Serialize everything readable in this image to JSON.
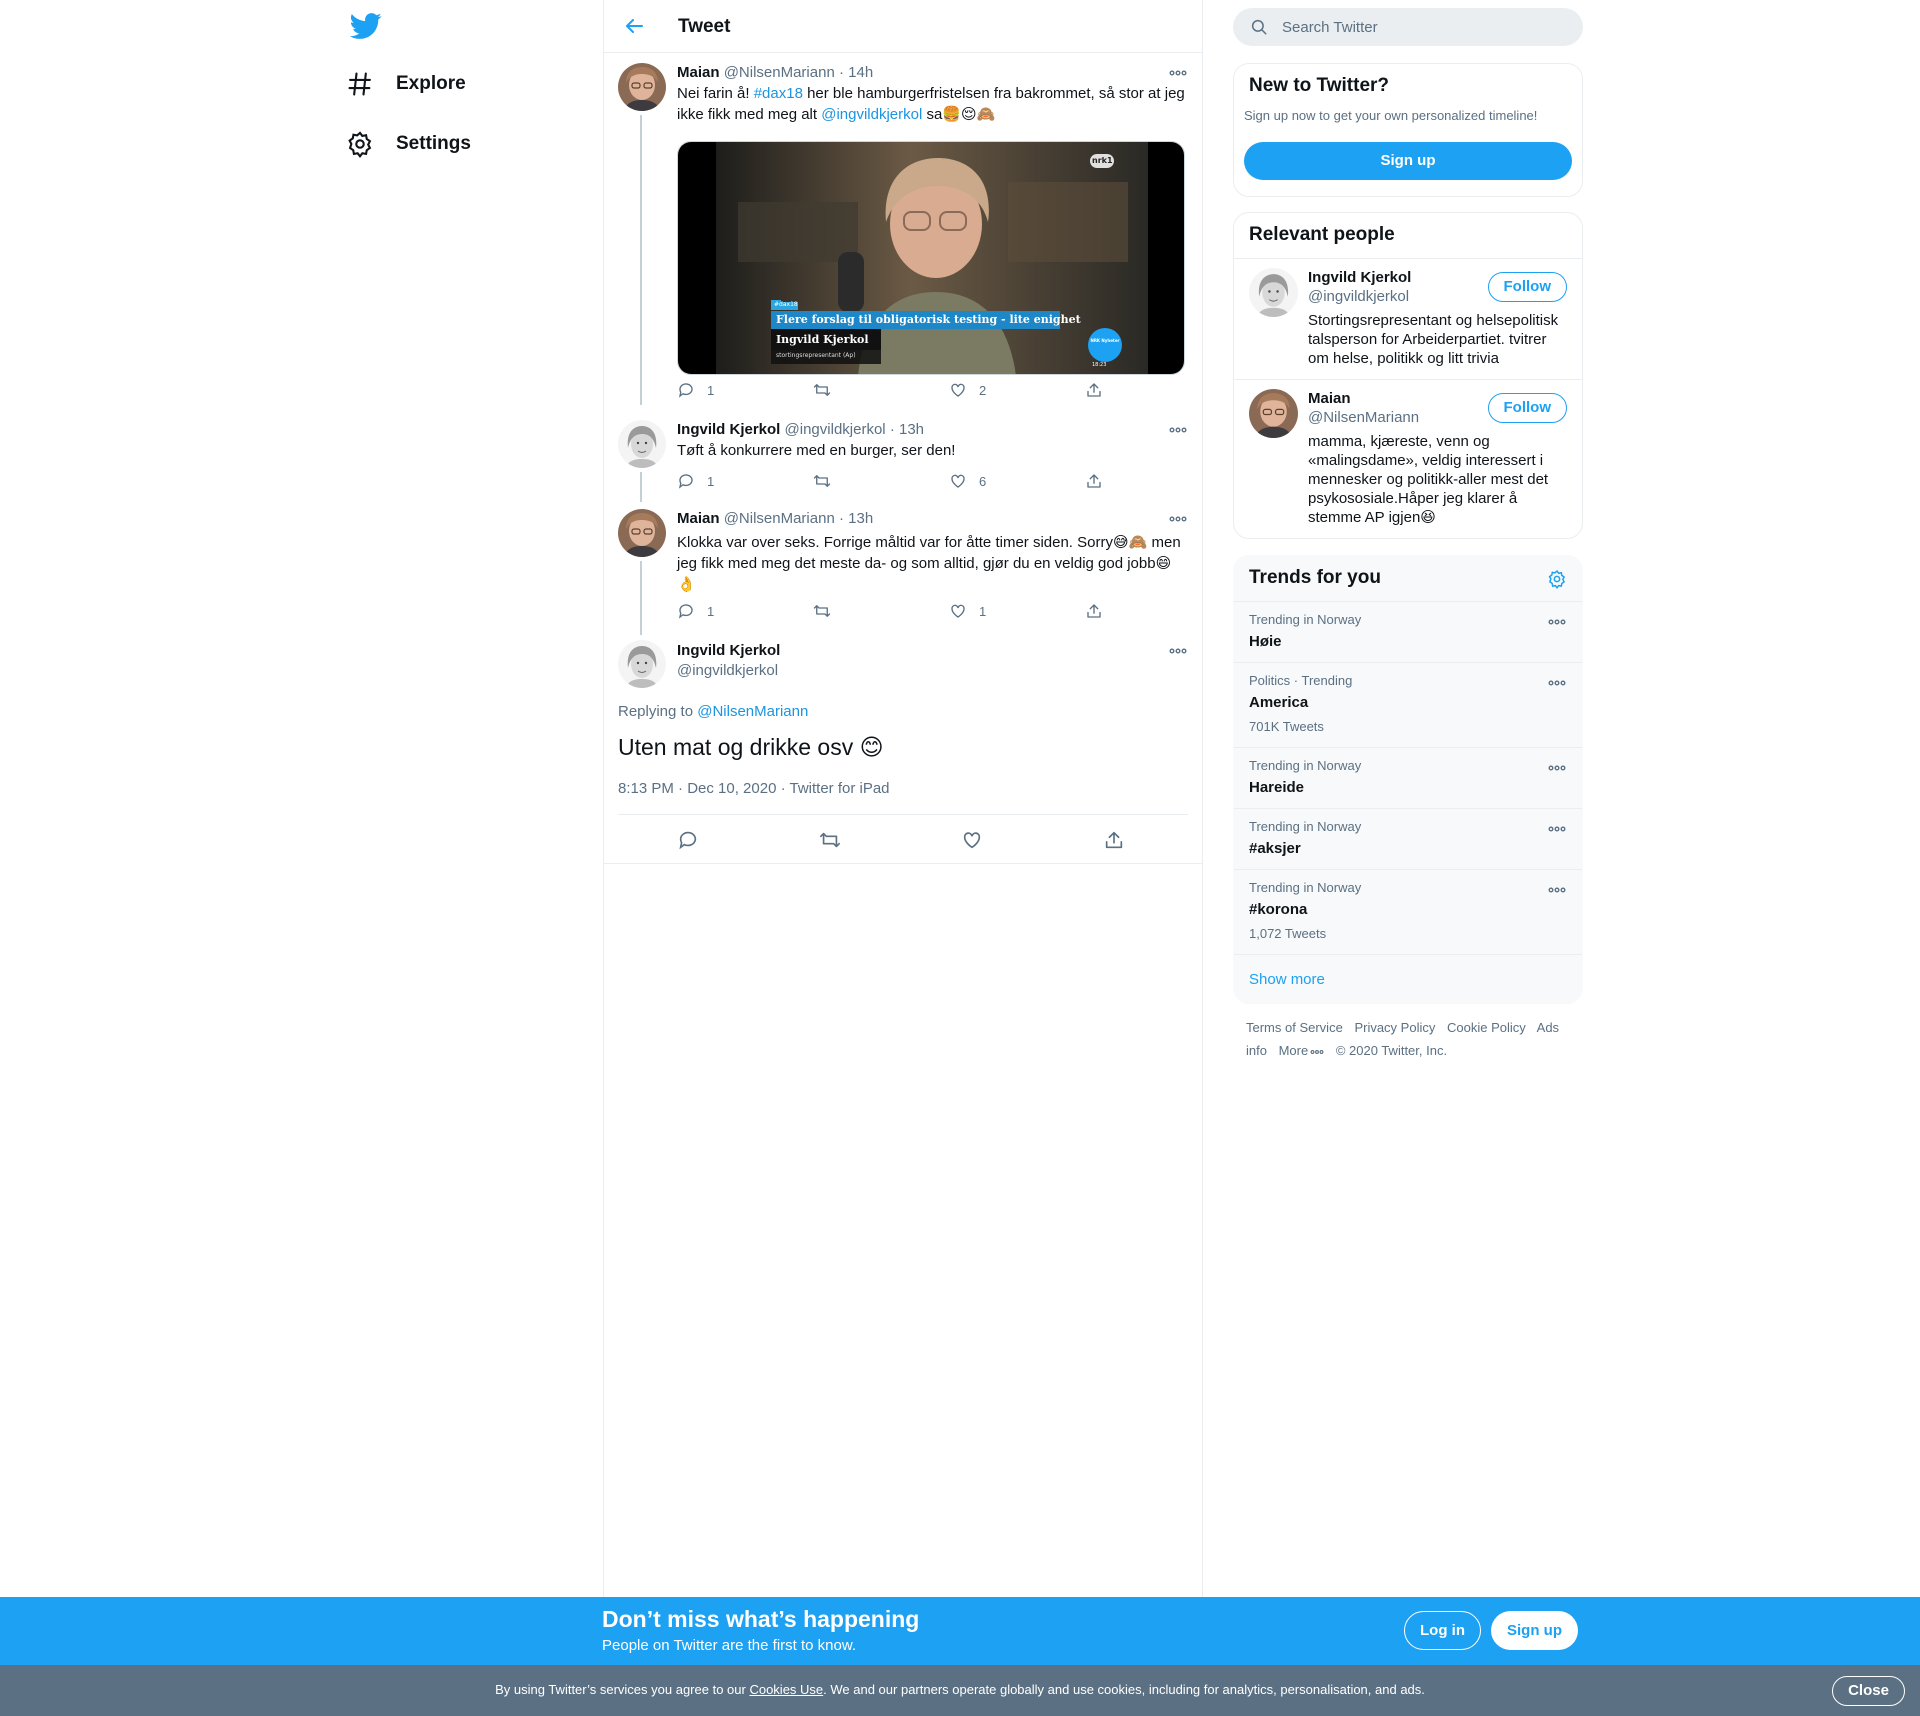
{
  "nav": {
    "logo_icon": "twitter-bird-icon",
    "items": [
      {
        "icon": "hashtag-icon",
        "label": "Explore"
      },
      {
        "icon": "gear-icon",
        "label": "Settings"
      }
    ]
  },
  "header": {
    "title": "Tweet",
    "back_icon": "arrow-left-icon"
  },
  "thread": [
    {
      "name": "Maian",
      "handle": "@NilsenMariann",
      "sep": "·",
      "time": "14h",
      "text_parts": [
        "Nei farin å! ",
        "#dax18",
        " her ble hamburgerfristelsen fra bakrommet, så stor at jeg ikke fikk med meg alt ",
        "@ingvildkjerkol",
        " sa",
        "🍔😌🙈"
      ],
      "media": {
        "headline_tag": "#dax18",
        "headline": "Flere forslag til obligatorisk testing - lite enighet",
        "person": "Ingvild Kjerkol",
        "role": "stortingsrepresentant (Ap)",
        "channel_top": "nrk1",
        "channel_logo": "NRK Nyheter",
        "clock": "18:23"
      },
      "reply_count": "1",
      "retweet_count": "",
      "like_count": "2"
    },
    {
      "name": "Ingvild Kjerkol",
      "handle": "@ingvildkjerkol",
      "sep": "·",
      "time": "13h",
      "text": "Tøft å konkurrere med en burger, ser den!",
      "reply_count": "1",
      "retweet_count": "",
      "like_count": "6"
    },
    {
      "name": "Maian",
      "handle": "@NilsenMariann",
      "sep": "·",
      "time": "13h",
      "text_line1": "Klokka var over seks. Forrige måltid var for åtte timer siden. Sorry",
      "emoji1": "😅🙈",
      "text_line2": "men jeg fikk med meg det meste da- og som alltid, gjør du en veldig god jobb",
      "emoji2": "😄👌",
      "reply_count": "1",
      "retweet_count": "",
      "like_count": "1"
    }
  ],
  "focus": {
    "name": "Ingvild Kjerkol",
    "handle": "@ingvildkjerkol",
    "replying_prefix": "Replying to",
    "replying_to": "@NilsenMariann",
    "text": "Uten mat og drikke osv",
    "emoji": "😊",
    "timestamp": "8:13 PM · Dec 10, 2020 · Twitter for iPad"
  },
  "sidebar": {
    "search_placeholder": "Search Twitter",
    "new_to_twitter": {
      "title": "New to Twitter?",
      "subtitle": "Sign up now to get your own personalized timeline!",
      "button": "Sign up"
    },
    "relevant": {
      "title": "Relevant people",
      "people": [
        {
          "name": "Ingvild Kjerkol",
          "handle": "@ingvildkjerkol",
          "bio": "Stortingsrepresentant og helsepolitisk talsperson for Arbeiderpartiet. tvitrer om helse, politikk og litt trivia",
          "follow": "Follow"
        },
        {
          "name": "Maian",
          "handle": "@NilsenMariann",
          "bio": "mamma, kjæreste, venn og «malingsdame», veldig interessert i mennesker og politikk-aller mest det psykososiale.Håper jeg klarer å stemme AP igjen",
          "bio_emoji": "😆",
          "follow": "Follow"
        }
      ]
    },
    "trends": {
      "title": "Trends for you",
      "settings_icon": "gear-icon",
      "items": [
        {
          "context": "Trending in Norway",
          "name": "Høie",
          "count": ""
        },
        {
          "context": "Politics · Trending",
          "name": "America",
          "count": "701K Tweets"
        },
        {
          "context": "Trending in Norway",
          "name": "Hareide",
          "count": ""
        },
        {
          "context": "Trending in Norway",
          "name": "#aksjer",
          "count": ""
        },
        {
          "context": "Trending in Norway",
          "name": "#korona",
          "count": "1,072 Tweets"
        }
      ],
      "show_more": "Show more"
    },
    "footer": {
      "terms": "Terms of Service",
      "privacy": "Privacy Policy",
      "cookie": "Cookie Policy",
      "ads": "Ads info",
      "more": "More",
      "copyright": "© 2020 Twitter, Inc."
    }
  },
  "signup_bar": {
    "title": "Don’t miss what’s happening",
    "subtitle": "People on Twitter are the first to know.",
    "login": "Log in",
    "signup": "Sign up"
  },
  "cookie_bar": {
    "text_before": "By using Twitter’s services you agree to our ",
    "link": "Cookies Use",
    "text_after": ". We and our partners operate globally and use cookies, including for analytics, personalisation, and ads.",
    "close": "Close"
  },
  "colors": {
    "accent": "#1da1f2",
    "link": "#1b95e0",
    "muted": "#5b7083",
    "cookie_bg": "#5b7083"
  }
}
